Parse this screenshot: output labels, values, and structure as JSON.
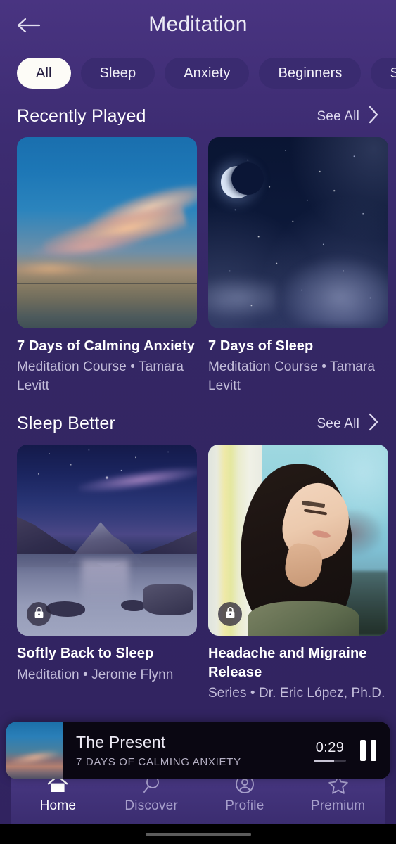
{
  "header": {
    "title": "Meditation",
    "back_icon": "arrow-left-icon"
  },
  "filters": [
    {
      "label": "All",
      "active": true
    },
    {
      "label": "Sleep",
      "active": false
    },
    {
      "label": "Anxiety",
      "active": false
    },
    {
      "label": "Beginners",
      "active": false
    },
    {
      "label": "Stress",
      "active": false
    }
  ],
  "sections": [
    {
      "title": "Recently Played",
      "see_all_label": "See All",
      "see_all_icon": "chevron-right-icon",
      "cards": [
        {
          "title": "7 Days of Calming Anxiety",
          "subtitle": "Meditation Course • Tamara Levitt",
          "artwork": "sunset-sky-over-water",
          "locked": false
        },
        {
          "title": "7 Days of Sleep",
          "subtitle": "Meditation Course • Tamara Levitt",
          "artwork": "night-sky-crescent-moon",
          "locked": false
        }
      ]
    },
    {
      "title": "Sleep Better",
      "see_all_label": "See All",
      "see_all_icon": "chevron-right-icon",
      "cards": [
        {
          "title": "Softly Back to Sleep",
          "subtitle": "Meditation • Jerome Flynn",
          "artwork": "twilight-mountain-lake",
          "locked": true,
          "lock_icon": "lock-icon"
        },
        {
          "title": "Headache and Migraine Release",
          "subtitle": "Series • Dr. Eric López, Ph.D.",
          "artwork": "woman-relaxing-in-sunlight",
          "locked": true,
          "lock_icon": "lock-icon"
        }
      ]
    }
  ],
  "player": {
    "title": "The Present",
    "subtitle": "7 DAYS OF CALMING ANXIETY",
    "time": "0:29",
    "progress_percent": 62,
    "artwork": "sunset-sky-over-water",
    "control_icon": "pause-icon"
  },
  "tabs": [
    {
      "label": "Home",
      "icon": "home-icon",
      "active": true
    },
    {
      "label": "Discover",
      "icon": "search-icon",
      "active": false
    },
    {
      "label": "Profile",
      "icon": "user-circle-icon",
      "active": false
    },
    {
      "label": "Premium",
      "icon": "star-icon",
      "active": false
    }
  ],
  "colors": {
    "background_top": "#493481",
    "background_bottom": "#312360",
    "chip_inactive": "#3a2b70",
    "chip_active": "#fdfcf7",
    "accent_text": "#ffffff",
    "muted_text": "#c3bdda",
    "player_background": "#0a0712"
  }
}
